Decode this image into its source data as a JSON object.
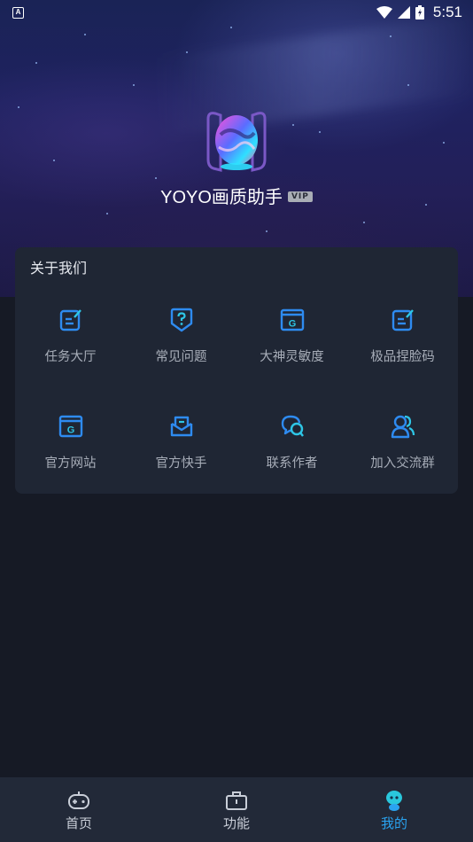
{
  "status_bar": {
    "time": "5:51",
    "app_icon_letter": "A"
  },
  "profile": {
    "app_name": "YOYO画质助手",
    "badge": "VIP"
  },
  "about_card": {
    "title": "关于我们",
    "items": [
      {
        "label": "任务大厅",
        "icon": "task-edit-icon"
      },
      {
        "label": "常见问题",
        "icon": "question-shield-icon"
      },
      {
        "label": "大神灵敏度",
        "icon": "g-browser-icon"
      },
      {
        "label": "极品捏脸码",
        "icon": "task-edit-icon"
      },
      {
        "label": "官方网站",
        "icon": "g-browser-icon"
      },
      {
        "label": "官方快手",
        "icon": "mail-open-icon"
      },
      {
        "label": "联系作者",
        "icon": "chat-bubbles-icon"
      },
      {
        "label": "加入交流群",
        "icon": "group-users-icon"
      }
    ]
  },
  "bottom_nav": [
    {
      "label": "首页",
      "icon": "gamepad-icon",
      "active": false
    },
    {
      "label": "功能",
      "icon": "toolbox-icon",
      "active": false
    },
    {
      "label": "我的",
      "icon": "mascot-icon",
      "active": true
    }
  ],
  "colors": {
    "accent": "#2aa3f0",
    "icon_blue": "#2e8bf0",
    "background": "#161a25",
    "card": "#1f2634"
  }
}
